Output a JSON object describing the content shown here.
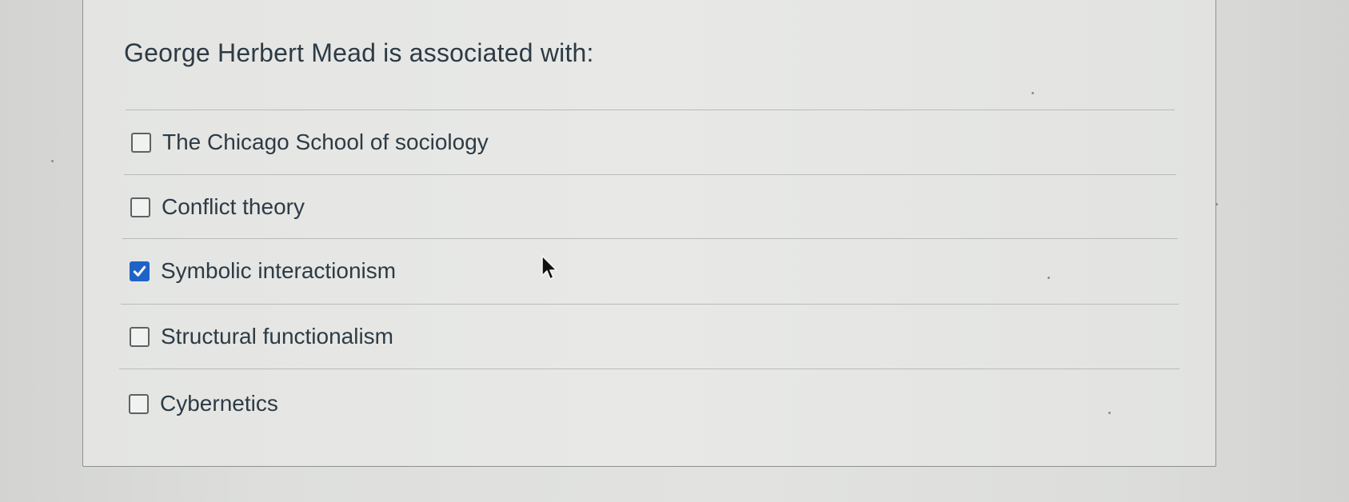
{
  "question": {
    "prompt": "George Herbert Mead is associated with:"
  },
  "answers": [
    {
      "label": "The Chicago School of sociology",
      "checked": false
    },
    {
      "label": "Conflict theory",
      "checked": false
    },
    {
      "label": "Symbolic interactionism",
      "checked": true
    },
    {
      "label": "Structural functionalism",
      "checked": false
    },
    {
      "label": "Cybernetics",
      "checked": false
    }
  ],
  "colors": {
    "text": "#2d3b45",
    "checkbox_checked": "#1f63c7"
  }
}
